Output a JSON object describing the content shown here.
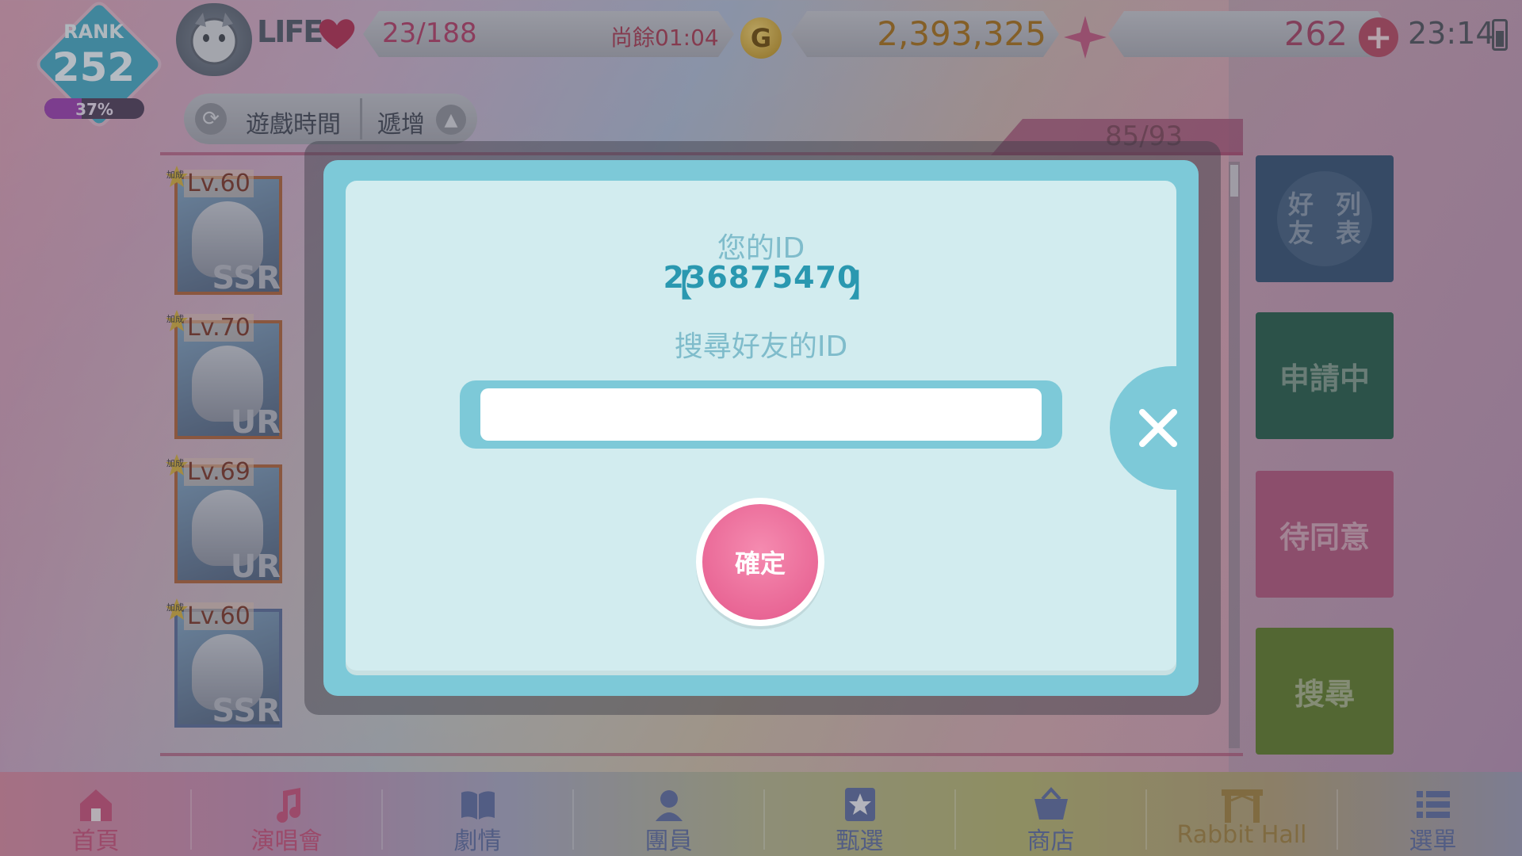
{
  "header": {
    "rank_label": "RANK",
    "rank_value": "252",
    "rank_progress": "37%",
    "rank_progress_fraction": 0.37,
    "life_label": "LIFE",
    "life_count": "23/188",
    "life_remaining": "尚餘01:04",
    "gold_icon": "G",
    "gold_amount": "2,393,325",
    "gem_amount": "262",
    "plus_label": "+",
    "clock": "23:14"
  },
  "sort": {
    "label": "遊戲時間",
    "order": "遞增"
  },
  "friend_list": {
    "count": "85/93",
    "cards": [
      {
        "level": "Lv.60",
        "rarity": "SSR",
        "bonus": "加成"
      },
      {
        "level": "Lv.70",
        "rarity": "UR",
        "bonus": "加成"
      },
      {
        "level": "Lv.69",
        "rarity": "UR",
        "bonus": "加成"
      },
      {
        "level": "Lv.60",
        "rarity": "SSR",
        "bonus": "加成"
      }
    ]
  },
  "side_tabs": {
    "friends": "好友\n列表",
    "friends_line1": "好友",
    "friends_line2": "列表",
    "pending": "申請中",
    "waiting": "待同意",
    "search": "搜尋"
  },
  "modal": {
    "your_id_label": "您的ID",
    "bracket_left": "【",
    "your_id": "236875470",
    "bracket_right": "】",
    "search_label": "搜尋好友的ID",
    "input_value": "",
    "input_placeholder": "",
    "confirm_label": "確定"
  },
  "bottom_nav": [
    {
      "label": "首頁",
      "icon": "home-icon",
      "color": "#c94d78"
    },
    {
      "label": "演唱會",
      "icon": "music-note-icon",
      "color": "#c94d78"
    },
    {
      "label": "劇情",
      "icon": "book-icon",
      "color": "#5a6aa0"
    },
    {
      "label": "團員",
      "icon": "member-icon",
      "color": "#5a6aa0"
    },
    {
      "label": "甄選",
      "icon": "star-card-icon",
      "color": "#5a6aa0"
    },
    {
      "label": "商店",
      "icon": "shop-basket-icon",
      "color": "#5a6aa0"
    },
    {
      "label": "Rabbit Hall",
      "icon": "gate-icon",
      "color": "#a0803a"
    },
    {
      "label": "選單",
      "icon": "list-menu-icon",
      "color": "#5a6aa0"
    }
  ],
  "colors": {
    "modal_frame": "#7dc9d8",
    "modal_body": "#d2ecef",
    "accent_id": "#2a98b0",
    "confirm": "#e4588b"
  }
}
